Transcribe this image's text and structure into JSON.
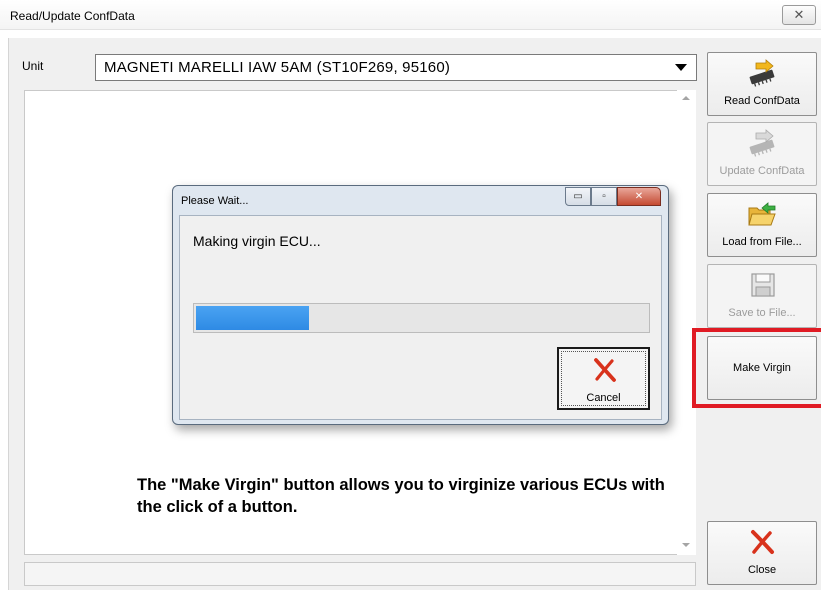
{
  "window": {
    "title": "Read/Update ConfData",
    "close_glyph": "✕"
  },
  "unit": {
    "label": "Unit",
    "selected": "MAGNETI MARELLI   IAW 5AM (ST10F269, 95160)"
  },
  "sidebar": {
    "read": "Read ConfData",
    "update": "Update ConfData",
    "load": "Load from File...",
    "save": "Save to File...",
    "virgin": "Make Virgin",
    "close": "Close"
  },
  "dialog": {
    "title": "Please Wait...",
    "message": "Making virgin ECU...",
    "progress": 0.25,
    "cancel": "Cancel",
    "min_glyph": "▭",
    "max_glyph": "▫",
    "close_glyph": "✕"
  },
  "caption": "The \"Make Virgin\" button allows you to virginize various ECUs with the click of a button.",
  "colors": {
    "highlight": "#e01b24",
    "progress_fill": "#2e8ae4",
    "close_x": "#d8321c"
  },
  "icons": {
    "read": "chip-read-icon",
    "update": "chip-update-icon",
    "load": "folder-open-icon",
    "save": "floppy-disk-icon",
    "close": "red-x-icon",
    "cancel": "red-x-icon"
  }
}
